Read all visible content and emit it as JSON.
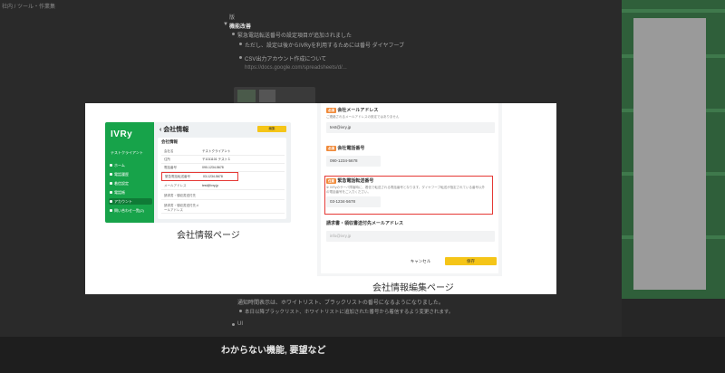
{
  "doc": {
    "crumb": "社内 / ツール・作業集",
    "lines": [
      "版",
      "機能改善",
      "緊急電話転送番号の設定項目が追加されました",
      "ただし、設定は後からIVRyを利用するためには番号 ダイヤフーブ",
      "CSV出力アカウント作成について",
      "https://docs.google.com/spreadsheets/d/...",
      "通知時間表示は、ホワイトリスト、ブラックリストの番号になるようになりました。",
      "本日以降ブラックリスト、ホワイトリストに追加された番号から着信するよう変更されます。",
      "UI",
      "わからない機能, 要望など"
    ]
  },
  "left_screenshot": {
    "logo": "IVRy",
    "client_name": "テストクライアント",
    "sidebar": [
      {
        "label": "ホーム",
        "active": false
      },
      {
        "label": "電話履歴",
        "active": false
      },
      {
        "label": "着信設定",
        "active": false
      },
      {
        "label": "電話帳",
        "active": false
      },
      {
        "label": "アカウント",
        "active": true
      },
      {
        "label": "問い合わせ一覧(2)",
        "active": false
      }
    ],
    "page_title": "会社情報",
    "edit_button": "編集",
    "card_title": "会社情報",
    "rows": [
      {
        "key": "会社名",
        "value": "テストクライアント"
      },
      {
        "key": "住所",
        "value": "〒1011101 テスト１"
      },
      {
        "key": "電話番号",
        "value": "090-1234-5678"
      },
      {
        "key": "緊急電話転送番号",
        "value": "03-1234-5678"
      },
      {
        "key": "メールアドレス",
        "value": "test@ivry.jp"
      },
      {
        "key": "請求書・領収書送付先",
        "value": ""
      },
      {
        "key": "請求書・領収書送付先メールアドレス",
        "value": ""
      }
    ],
    "caption": "会社情報ページ"
  },
  "right_screenshot": {
    "fields": [
      {
        "badge": "必須",
        "label": "会社メールアドレス",
        "hint": "ご連絡されるメールアドレスの設定ではありません",
        "value": "test@ivry.jp",
        "placeholder": false
      },
      {
        "badge": "必須",
        "label": "会社電話番号",
        "hint": "",
        "value": "090-1234-5678",
        "placeholder": false
      },
      {
        "badge": "任意",
        "label": "緊急電話転送番号",
        "hint": "※ IVRyのサーバ障害時に、着信で転送される電話番号となります。ダイヤフーブ転送が指定されている番号以外の電話番号をご入力ください。",
        "value": "03-1234-5678",
        "placeholder": false
      },
      {
        "badge": "",
        "label": "請求書・領収書送付先メールアドレス",
        "hint": "",
        "value": "info@ivry.jp",
        "placeholder": true
      }
    ],
    "cancel_button": "キャンセル",
    "save_button": "保存",
    "caption": "会社情報編集ページ"
  },
  "colors": {
    "brand_green": "#17a34a",
    "highlight_red": "#e53935",
    "accent_yellow": "#f5c518",
    "badge_orange": "#f08a3a"
  }
}
